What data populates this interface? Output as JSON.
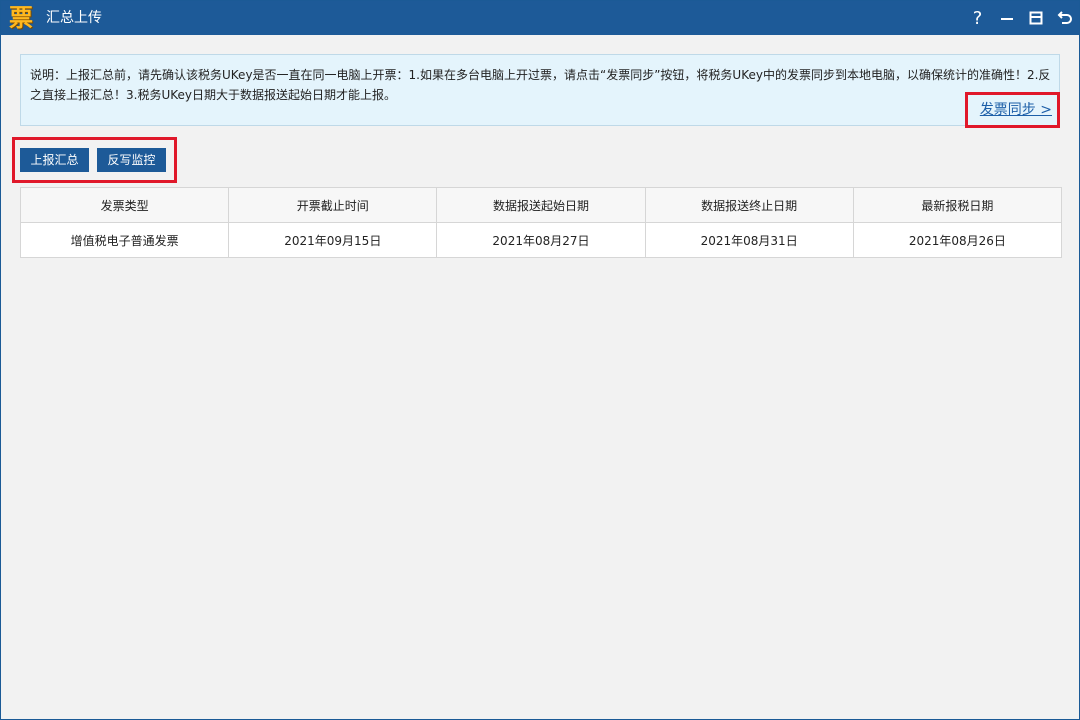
{
  "window": {
    "title": "汇总上传",
    "logo_glyph": "票",
    "controls": [
      "help-icon",
      "minimize-icon",
      "restore-icon",
      "back-icon"
    ],
    "help_glyph": "?"
  },
  "notice": {
    "text": "说明：上报汇总前，请先确认该税务UKey是否一直在同一电脑上开票：1.如果在多台电脑上开过票，请点击“发票同步”按钮，将税务UKey中的发票同步到本地电脑，以确保统计的准确性！2.反之直接上报汇总！3.税务UKey日期大于数据报送起始日期才能上报。",
    "sync_link": "发票同步 >"
  },
  "actions": {
    "report_label": "上报汇总",
    "writeback_label": "反写监控"
  },
  "table": {
    "columns": [
      "发票类型",
      "开票截止时间",
      "数据报送起始日期",
      "数据报送终止日期",
      "最新报税日期"
    ],
    "rows": [
      [
        "增值税电子普通发票",
        "2021年09月15日",
        "2021年08月27日",
        "2021年08月31日",
        "2021年08月26日"
      ]
    ]
  },
  "colors": {
    "titlebar": "#1d5a98",
    "button": "#1d5a98",
    "highlight": "#e0182a",
    "link": "#1d5fa8",
    "notice_bg": "#e4f4fc"
  }
}
